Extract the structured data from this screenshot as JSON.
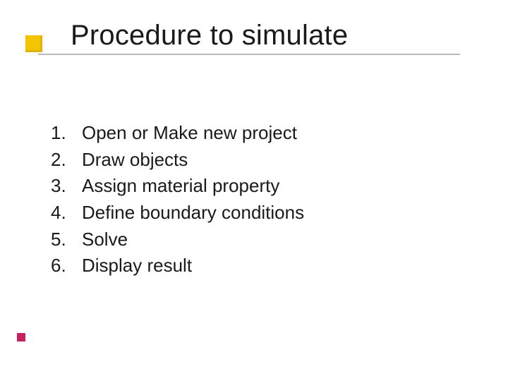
{
  "title": "Procedure to simulate",
  "steps": [
    "Open or Make new project",
    "Draw objects",
    "Assign material property",
    "Define boundary conditions",
    "Solve",
    "Display result"
  ],
  "colors": {
    "bullet": "#f3c400",
    "underline": "#b9b9b9",
    "accent": "#c62060"
  }
}
